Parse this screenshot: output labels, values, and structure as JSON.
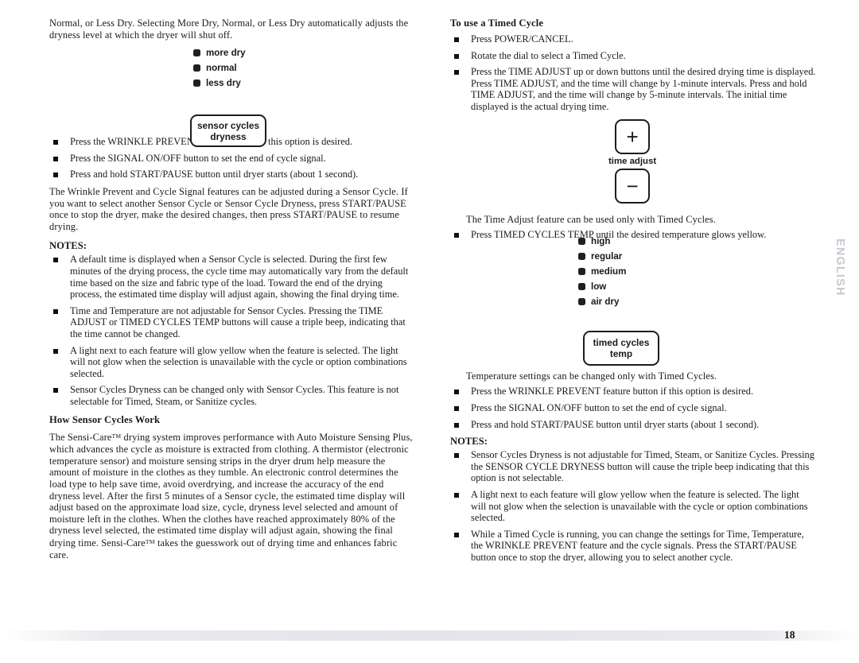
{
  "page": {
    "number": "18",
    "side_tab": "ENGLISH"
  },
  "left_column": {
    "intro_paragraph": "Normal, or Less Dry. Selecting More Dry, Normal, or Less Dry automatically adjusts the dryness level at which the dryer will shut off.",
    "dryness_options": [
      {
        "label": "more dry"
      },
      {
        "label": "normal"
      },
      {
        "label": "less dry"
      }
    ],
    "sensor_cycles_button": {
      "line1": "sensor cycles",
      "line2": "dryness"
    },
    "steps": [
      "Press the WRINKLE PREVENT feature button if this option is desired.",
      "Press the SIGNAL ON/OFF button to set the end of cycle signal.",
      "Press and hold START/PAUSE button until dryer starts (about 1 second)."
    ],
    "after_steps_paragraph": "The Wrinkle Prevent and Cycle Signal features can be adjusted during a Sensor Cycle. If you want to select another Sensor Cycle or Sensor Cycle Dryness, press START/PAUSE once to stop the dryer, make the desired changes, then press START/PAUSE  to resume drying.",
    "notes_label": "NOTES:",
    "notes": [
      "A default time is displayed when a Sensor Cycle is selected. During the first few minutes of the drying process, the cycle time may automatically vary from the default time based on the size and fabric type of the load. Toward the end of the drying process, the estimated time display will adjust again, showing the final drying time.",
      "Time and Temperature are not adjustable for Sensor Cycles. Pressing the TIME ADJUST or TIMED CYCLES TEMP buttons will cause a triple beep, indicating that the time cannot be changed.",
      "A light next to each feature will glow yellow when the feature is selected. The light will not glow when the selection is unavailable with the cycle or option combinations selected.",
      "Sensor Cycles Dryness can be changed only with Sensor Cycles. This feature is not selectable for Timed, Steam, or Sanitize cycles."
    ],
    "how_heading": "How Sensor Cycles Work",
    "how_paragraph_part1": "The Sensi-Care",
    "how_paragraph_part2": " drying system improves performance with Auto Moisture Sensing Plus, which advances the cycle as moisture is extracted from clothing.  A thermistor (electronic temperature sensor) and moisture sensing strips in the dryer drum help measure the amount of moisture in the clothes as they tumble. An electronic control determines the load type to help save time, avoid overdrying, and increase the accuracy of the end dryness level. After the first 5 minutes of a Sensor cycle, the estimated time display will adjust based on the approximate load size, cycle, dryness level selected and amount of moisture left in the clothes. When the clothes have reached approximately 80% of the dryness level selected, the estimated time display will adjust again, showing the final drying time. Sensi-Care",
    "how_paragraph_part3": " takes the guesswork out of drying time and enhances fabric care.",
    "trademark": "TM"
  },
  "right_column": {
    "heading": "To use a Timed Cycle",
    "steps": [
      "Press POWER/CANCEL.",
      "Rotate the dial to select a Timed Cycle.",
      "Press the TIME ADJUST up or down buttons until the desired drying time is displayed. Press TIME ADJUST, and the time will change by 1-minute intervals. Press and hold TIME ADJUST, and the time will change by 5-minute intervals. The initial time displayed is the actual drying time."
    ],
    "time_adjust": {
      "plus_label": "+",
      "minus_label": "−",
      "caption": "time adjust"
    },
    "time_adjust_note": "The Time Adjust feature can be used only with Timed Cycles.",
    "temp_step": "Press TIMED CYCLES TEMP until the desired temperature glows yellow.",
    "temp_options": [
      {
        "label": "high"
      },
      {
        "label": "regular"
      },
      {
        "label": "medium"
      },
      {
        "label": "low"
      },
      {
        "label": "air dry"
      }
    ],
    "timed_cycles_button": {
      "line1": "timed cycles",
      "line2": "temp"
    },
    "temp_note": "Temperature settings can be changed only with Timed Cycles.",
    "steps2": [
      "Press the WRINKLE PREVENT feature button if this option is desired.",
      "Press the SIGNAL ON/OFF button to set the end of cycle signal.",
      "Press and hold START/PAUSE button until dryer starts (about 1 second)."
    ],
    "notes_label": "NOTES:",
    "notes": [
      "Sensor Cycles Dryness is not adjustable for Timed, Steam, or Sanitize Cycles. Pressing the SENSOR CYCLE DRYNESS button will cause the triple beep indicating that this option is not selectable.",
      "A light next to each feature will glow yellow when the feature is selected. The light will not glow when the selection is unavailable with the cycle or option combinations selected.",
      "While a Timed Cycle is running, you can change the settings for Time, Temperature, the WRINKLE PREVENT feature and the cycle signals. Press the START/PAUSE button once to stop the dryer, allowing you to select another cycle."
    ]
  },
  "colors": {
    "ink": "#1a1a1a",
    "button_outline": "#201c1c",
    "led_square": "#241f1f",
    "side_tab": "#c8c8d0"
  }
}
